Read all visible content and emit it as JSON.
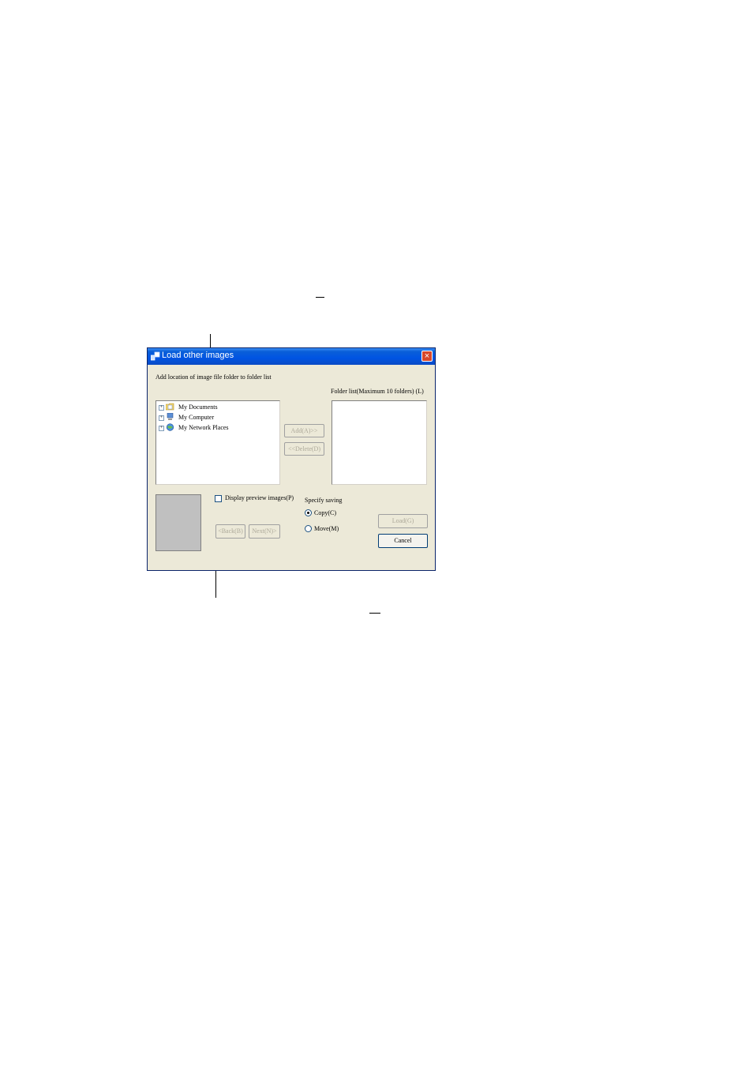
{
  "dialog": {
    "title": "Load other images",
    "close_glyph": "×",
    "instruction": "Add location of image file folder to folder list",
    "folder_list_label": "Folder list(Maximum 10 folders) (L)",
    "tree": {
      "items": [
        {
          "label": "My Documents",
          "icon": "my-documents-icon"
        },
        {
          "label": "My Computer",
          "icon": "my-computer-icon"
        },
        {
          "label": "My Network Places",
          "icon": "network-places-icon"
        }
      ],
      "expander_glyph": "+"
    },
    "buttons": {
      "add": "Add(A)>>",
      "delete": "<<Delete(D)",
      "back": "<Back(B)",
      "next": "Next(N)>",
      "load": "Load(G)",
      "cancel": "Cancel"
    },
    "preview_checkbox_label": "Display preview images(P)",
    "saving": {
      "label": "Specify saving",
      "options": [
        {
          "label": "Copy(C)",
          "selected": true
        },
        {
          "label": "Move(M)",
          "selected": false
        }
      ]
    }
  },
  "colors": {
    "titlebar": "#0054e3",
    "dialog_bg": "#ece9d8",
    "close_button": "#d8472a",
    "preview_area": "#c0c0c0"
  }
}
